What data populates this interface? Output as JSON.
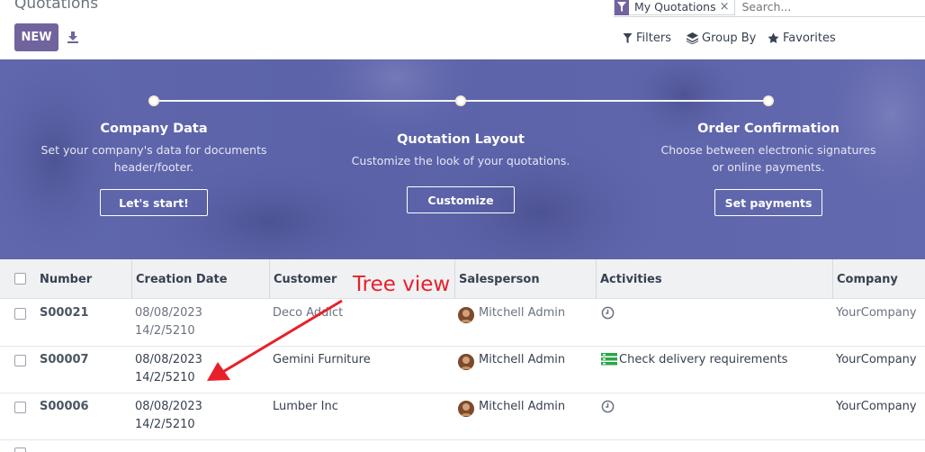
{
  "page": {
    "title": "Quotations"
  },
  "toolbar": {
    "new_label": "NEW"
  },
  "search": {
    "facet_label": "My Quotations",
    "facet_remove": "×",
    "placeholder": "Search..."
  },
  "filters": {
    "filters_label": "Filters",
    "group_by_label": "Group By",
    "favorites_label": "Favorites"
  },
  "onboarding": {
    "steps": [
      {
        "title": "Company Data",
        "desc_line1": "Set your company's data for documents",
        "desc_line2": "header/footer.",
        "button": "Let's start!"
      },
      {
        "title": "Quotation Layout",
        "desc_line1": "Customize the look of your quotations.",
        "desc_line2": "",
        "button": "Customize"
      },
      {
        "title": "Order Confirmation",
        "desc_line1": "Choose between electronic signatures",
        "desc_line2": "or online payments.",
        "button": "Set payments"
      }
    ]
  },
  "table": {
    "columns": [
      "Number",
      "Creation Date",
      "Customer",
      "Salesperson",
      "Activities",
      "Company"
    ],
    "rows": [
      {
        "number": "S00021",
        "date": "08/08/2023",
        "date2": "14/2/5210",
        "customer": "Deco Addict",
        "salesperson": "Mitchell Admin",
        "activity": "",
        "activity_icon": "clock-icon",
        "company": "YourCompany"
      },
      {
        "number": "S00007",
        "date": "08/08/2023",
        "date2": "14/2/5210",
        "customer": "Gemini Furniture",
        "salesperson": "Mitchell Admin",
        "activity": "Check delivery requirements",
        "activity_icon": "todo-list-icon",
        "company": "YourCompany"
      },
      {
        "number": "S00006",
        "date": "08/08/2023",
        "date2": "14/2/5210",
        "customer": "Lumber Inc",
        "salesperson": "Mitchell Admin",
        "activity": "",
        "activity_icon": "clock-icon",
        "company": "YourCompany"
      }
    ]
  },
  "annotation": {
    "text": "Tree view"
  },
  "colors": {
    "brand": "#71639e",
    "banner": "#5b62a8",
    "annotation": "#e8202a",
    "activity_green": "#28a745"
  }
}
